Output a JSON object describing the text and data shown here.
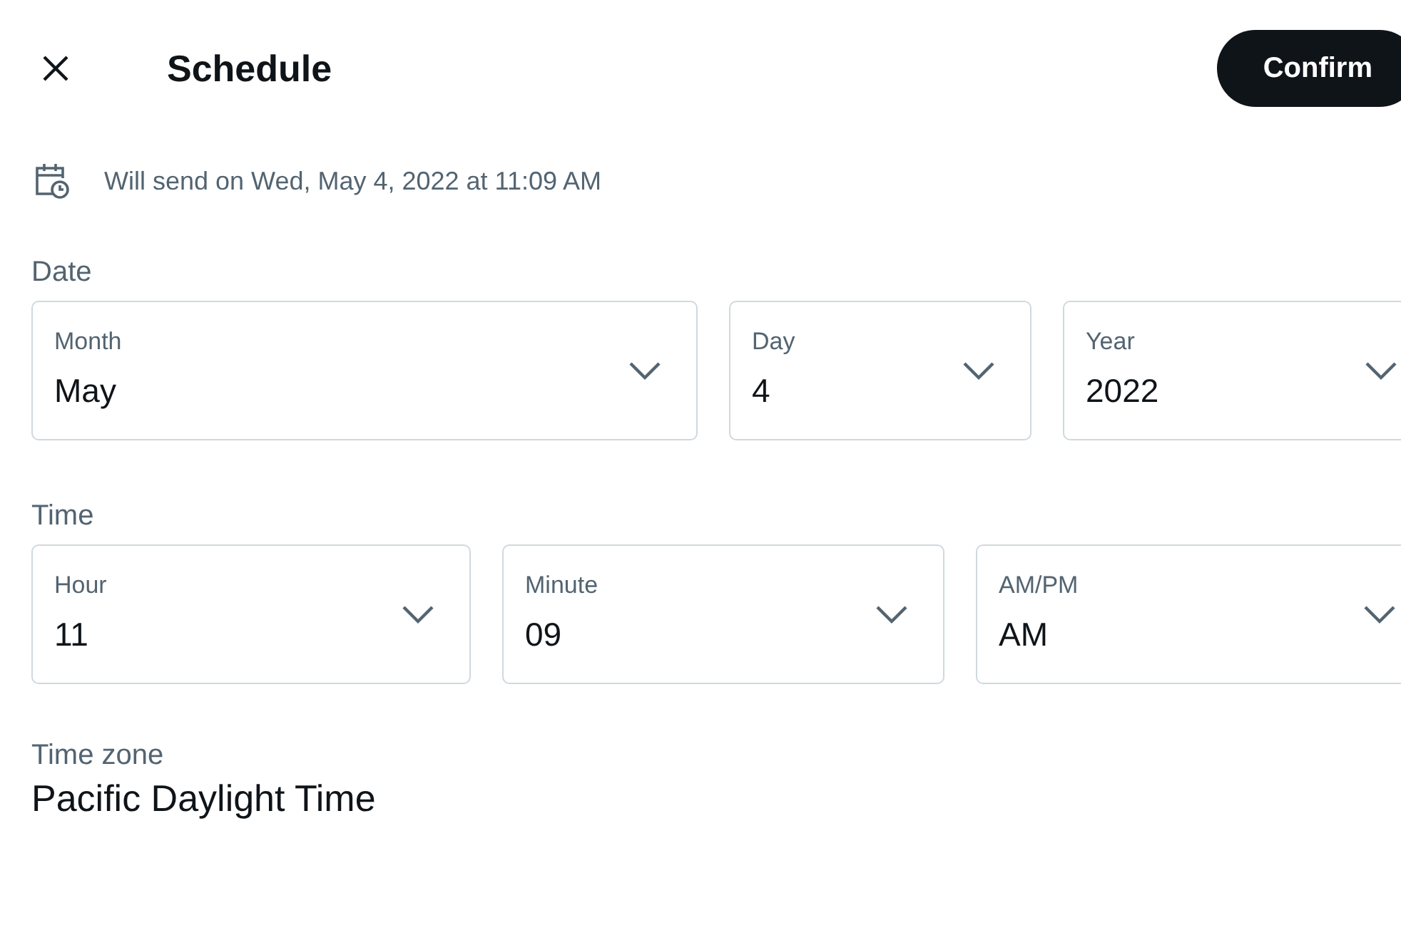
{
  "header": {
    "title": "Schedule",
    "confirm": "Confirm"
  },
  "summary": "Will send on Wed, May 4, 2022 at 11:09 AM",
  "date": {
    "label": "Date",
    "fields": [
      {
        "label": "Month",
        "value": "May"
      },
      {
        "label": "Day",
        "value": "4"
      },
      {
        "label": "Year",
        "value": "2022"
      }
    ]
  },
  "time": {
    "label": "Time",
    "fields": [
      {
        "label": "Hour",
        "value": "11"
      },
      {
        "label": "Minute",
        "value": "09"
      },
      {
        "label": "AM/PM",
        "value": "AM"
      }
    ]
  },
  "time_zone": {
    "label": "Time zone",
    "value": "Pacific Daylight Time"
  }
}
